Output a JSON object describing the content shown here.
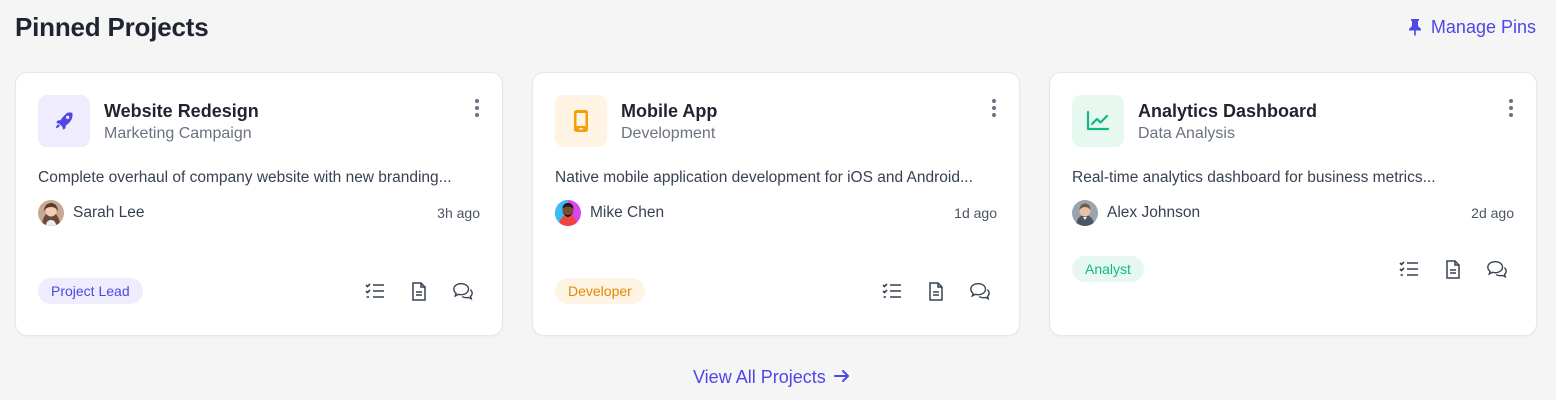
{
  "header": {
    "title": "Pinned Projects",
    "manage_label": "Manage Pins"
  },
  "colors": {
    "accent": "#4f46e5",
    "purple_bg": "#eeecfd",
    "purple": "#4f46e5",
    "orange_bg": "#fff3e3",
    "orange": "#f59e0b",
    "green_bg": "#e7f8f0",
    "green": "#10b981"
  },
  "projects": [
    {
      "title": "Website Redesign",
      "subtitle": "Marketing Campaign",
      "icon": "rocket-icon",
      "description": "Complete overhaul of company website with new branding...",
      "owner": "Sarah Lee",
      "time": "3h ago",
      "role": "Project Lead"
    },
    {
      "title": "Mobile App",
      "subtitle": "Development",
      "icon": "mobile-icon",
      "description": "Native mobile application development for iOS and Android...",
      "owner": "Mike Chen",
      "time": "1d ago",
      "role": "Developer"
    },
    {
      "title": "Analytics Dashboard",
      "subtitle": "Data Analysis",
      "icon": "chart-line-icon",
      "description": "Real-time analytics dashboard for business metrics...",
      "owner": "Alex Johnson",
      "time": "2d ago",
      "role": "Analyst"
    }
  ],
  "footer": {
    "view_all_label": "View All Projects"
  }
}
